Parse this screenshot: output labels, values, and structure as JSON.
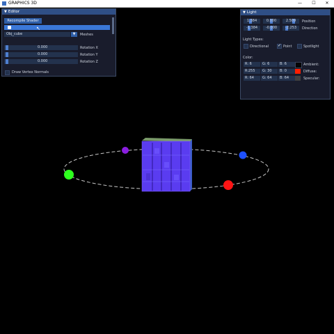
{
  "window": {
    "title": "GRAPHICS 3D",
    "minimize": "—",
    "maximize": "☐",
    "close": "✕"
  },
  "editor": {
    "title": "Editor",
    "recompile_label": "Recompile Shader",
    "mesh_value": "Obj_cube",
    "mesh_label": "Meshes",
    "rotation_x": {
      "value": "0.000",
      "label": "Rotation X"
    },
    "rotation_y": {
      "value": "0.000",
      "label": "Rotation Y"
    },
    "rotation_z": {
      "value": "0.000",
      "label": "Rotation Z"
    },
    "draw_normals_label": "Draw Vertex Normals"
  },
  "light": {
    "title": "Light",
    "position": {
      "x": "1.384",
      "y": "0.000",
      "z": "2.509",
      "label": "Position"
    },
    "direction": {
      "x": "-1.384",
      "y": "-0.000",
      "z": "-2.253",
      "label": "Direction"
    },
    "types_label": "Light Types:",
    "types": {
      "directional": "Directional",
      "point": "Point",
      "spotlight": "Spotlight"
    },
    "color_label": "Color:",
    "ambient": {
      "r": "R: 6",
      "g": "G: 6",
      "b": "B: 6",
      "label": "Ambient:",
      "swatch": "#060606"
    },
    "diffuse": {
      "r": "R:255",
      "g": "G: 30",
      "b": "B: 0",
      "label": "Diffuse:",
      "swatch": "#ff1e00"
    },
    "specular": {
      "r": "R: 64",
      "g": "G: 64",
      "b": "B: 64",
      "label": "Specular:",
      "swatch": "#404040"
    }
  },
  "scene": {
    "colors": {
      "purple_light": "#8a1ee0",
      "blue_light": "#1e50ff",
      "green_light": "#2eff1e",
      "red_light": "#ff1414",
      "cube_face": "#5a3cf0",
      "orbit": "#c8c8c8"
    }
  }
}
